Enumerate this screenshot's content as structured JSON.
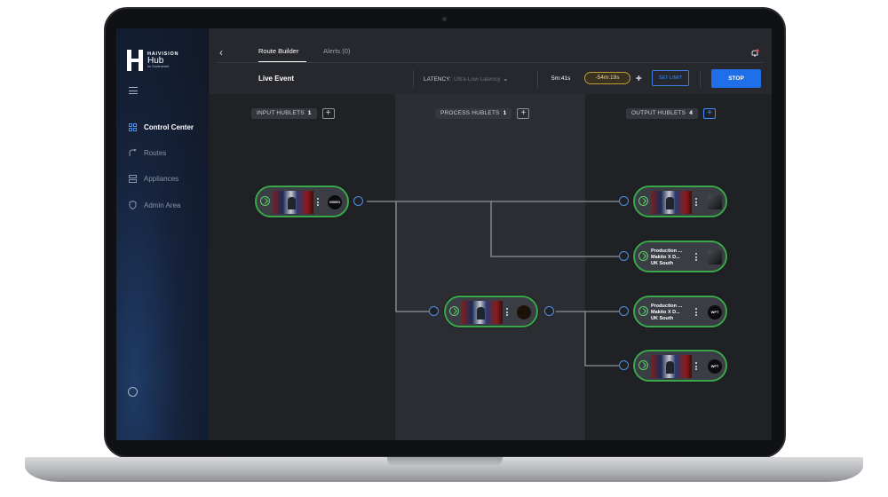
{
  "app": {
    "brand": "HAIVISION",
    "product": "Hub",
    "subtitle": "for Government"
  },
  "sidebar": {
    "items": [
      {
        "label": "Control Center",
        "icon": "grid-icon",
        "active": true
      },
      {
        "label": "Routes",
        "icon": "routes-icon",
        "active": false
      },
      {
        "label": "Appliances",
        "icon": "server-icon",
        "active": false
      },
      {
        "label": "Admin Area",
        "icon": "shield-icon",
        "active": false
      }
    ]
  },
  "header": {
    "tabs": [
      {
        "label": "Route Builder",
        "active": true
      },
      {
        "label": "Alerts (0)",
        "active": false
      }
    ],
    "event_title": "Live Event",
    "latency_label": "LATENCY:",
    "latency_value": "Ultra-Low Latency",
    "elapsed": "5m:41s",
    "remaining": "-54m:19s",
    "set_limit_label": "SET LIMIT",
    "stop_label": "STOP"
  },
  "columns": {
    "input": {
      "label": "INPUT HUBLETS",
      "count": "1"
    },
    "process": {
      "label": "PROCESS HUBLETS",
      "count": "1"
    },
    "output": {
      "label": "OUTPUT HUBLETS",
      "count": "4"
    }
  },
  "hublets": {
    "input_1": {
      "badge": "VIDEO"
    },
    "process_1": {
      "badge": ""
    },
    "output_1": {
      "badge": ""
    },
    "output_2": {
      "line1": "Production ...",
      "line2": "Makito X D...",
      "line3": "UK South"
    },
    "output_3": {
      "line1": "Production ...",
      "line2": "Makito X D...",
      "line3": "UK South",
      "badge": "WFT"
    },
    "output_4": {
      "badge": "WFT"
    }
  },
  "colors": {
    "accent": "#1f6fe8",
    "status_ok": "#3aa84a",
    "port": "#4f8fe6",
    "warning": "#c49a38"
  }
}
